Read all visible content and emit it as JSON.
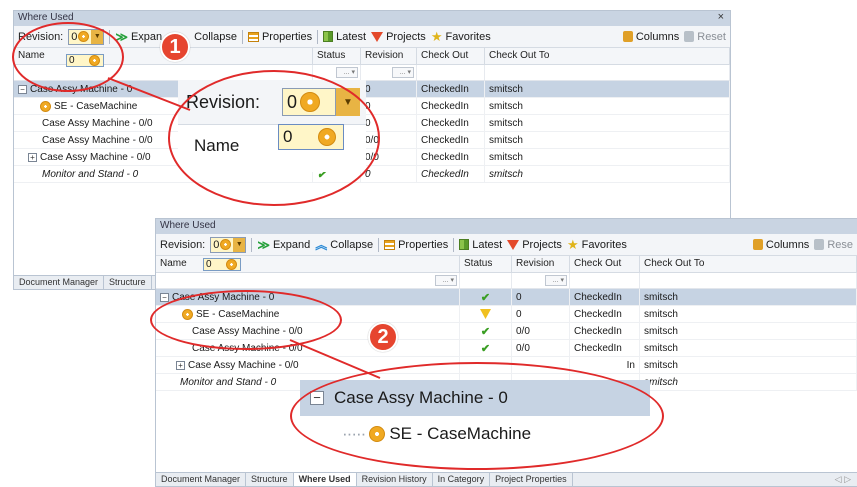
{
  "window_title": "Where Used",
  "close_glyph": "×",
  "toolbar": {
    "revision_label": "Revision:",
    "revision_value": "0",
    "expand_label": "Expand",
    "collapse_label": "Collapse",
    "collapse_label_partial": "Collapse",
    "expand_label_partial": "Expan",
    "properties_label": "Properties",
    "latest_label": "Latest",
    "projects_label": "Projects",
    "favorites_label": "Favorites",
    "columns_label": "Columns",
    "reset_label": "Reset",
    "reset_label_partial": "Rese",
    "dropdown_option": "0"
  },
  "columns": [
    "Name",
    "Status",
    "Revision",
    "Check Out",
    "Check Out To"
  ],
  "filter_glyph": "... ▾",
  "rows_top": [
    {
      "name": "Case Assy Machine - 0",
      "revision": "0",
      "checkout": "CheckedIn",
      "to": "smitsch"
    },
    {
      "name": "SE - CaseMachine",
      "revision": "0",
      "checkout": "CheckedIn",
      "to": "smitsch"
    },
    {
      "name": "Case Assy Machine - 0/0",
      "revision": "0",
      "checkout": "CheckedIn",
      "to": "smitsch"
    },
    {
      "name": "Case Assy Machine - 0/0",
      "revision": "0/0",
      "checkout": "CheckedIn",
      "to": "smitsch"
    },
    {
      "name": "Case Assy Machine - 0/0",
      "revision": "0/0",
      "checkout": "CheckedIn",
      "to": "smitsch"
    },
    {
      "name": "Monitor and Stand - 0",
      "revision": "0",
      "checkout": "CheckedIn",
      "to": "smitsch"
    }
  ],
  "rows_bottom": [
    {
      "name": "Case Assy Machine - 0",
      "revision": "0",
      "checkout": "CheckedIn",
      "to": "smitsch"
    },
    {
      "name": "SE - CaseMachine",
      "revision": "0",
      "checkout": "CheckedIn",
      "to": "smitsch"
    },
    {
      "name": "Case Assy Machine - 0/0",
      "revision": "0/0",
      "checkout": "CheckedIn",
      "to": "smitsch"
    },
    {
      "name": "Case Assy Machine - 0/0",
      "revision": "0/0",
      "checkout": "CheckedIn",
      "to": "smitsch"
    },
    {
      "name": "Case Assy Machine - 0/0",
      "revision": "",
      "checkout": "In",
      "to": "smitsch"
    },
    {
      "name": "Monitor and Stand - 0",
      "revision": "",
      "checkout": "",
      "to": "smitsch"
    }
  ],
  "tabs_top": [
    "Document Manager",
    "Structure"
  ],
  "tabs_bottom": [
    "Document Manager",
    "Structure",
    "Where Used",
    "Revision History",
    "In Category",
    "Project Properties"
  ],
  "tabs_nav": "◁ ▷",
  "zoom1": {
    "revision_label": "Revision:",
    "value": "0",
    "name_header": "Name",
    "option": "0"
  },
  "zoom2": {
    "row1": "Case Assy Machine - 0",
    "row2": "SE - CaseMachine"
  },
  "callouts": [
    "1",
    "2"
  ],
  "icons": {
    "checkmark": "✔",
    "expander_plus": "+",
    "expander_minus": "−",
    "dropdown": "▼",
    "star": "★"
  },
  "colors": {
    "callout": "#e6452f",
    "ellipse": "#e02a2a",
    "selected_row": "#c6d3e3",
    "titlebar": "#c9d4e2"
  }
}
